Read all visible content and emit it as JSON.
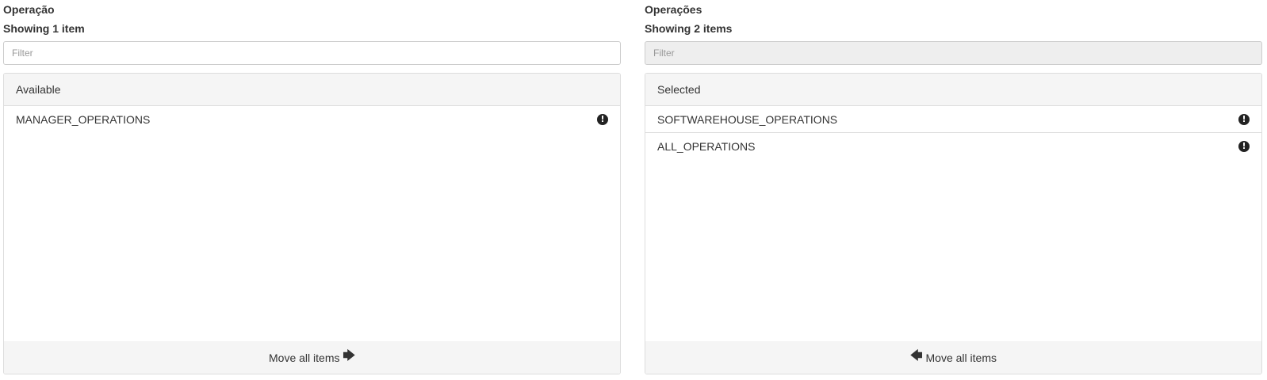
{
  "available": {
    "title": "Operação",
    "count_text": "Showing 1 item",
    "filter_placeholder": "Filter",
    "heading": "Available",
    "items": [
      {
        "label": "MANAGER_OPERATIONS",
        "icon": "!"
      }
    ],
    "move_all_label": "Move all items",
    "move_all_arrow": "🡆"
  },
  "selected": {
    "title": "Operações",
    "count_text": "Showing 2 items",
    "filter_placeholder": "Filter",
    "heading": "Selected",
    "items": [
      {
        "label": "SOFTWAREHOUSE_OPERATIONS",
        "icon": "!"
      },
      {
        "label": "ALL_OPERATIONS",
        "icon": "!"
      }
    ],
    "move_all_label": "Move all items",
    "move_all_arrow": "🡄"
  }
}
